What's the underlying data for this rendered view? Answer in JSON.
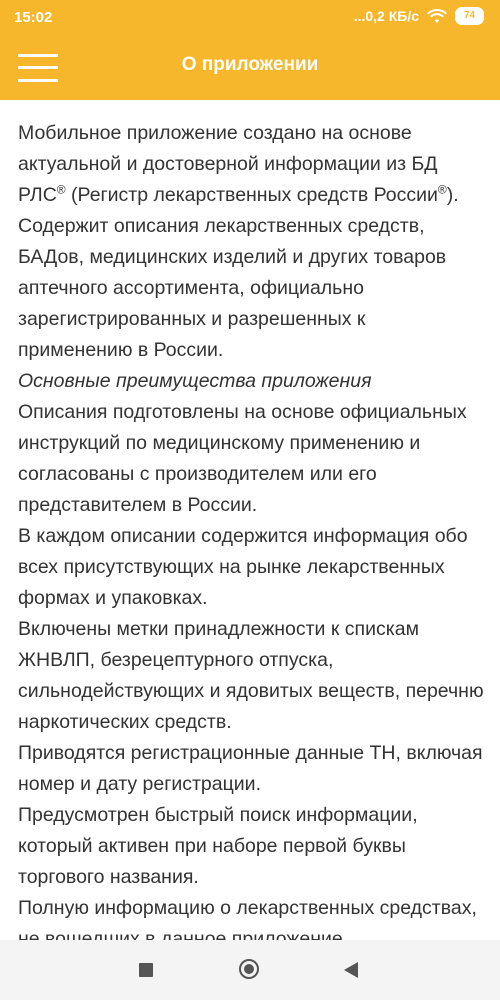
{
  "status_bar": {
    "time": "15:02",
    "network_speed": "...0,2 КБ/с",
    "battery_level": "74",
    "icons": [
      "wifi-icon",
      "battery-icon"
    ]
  },
  "app_bar": {
    "title": "О приложении",
    "menu_icon": "hamburger-menu-icon",
    "background_color": "#f7b72d",
    "text_color": "#ffffff"
  },
  "content": {
    "intro_part1": "Мобильное приложение создано на основе актуальной и достоверной информации из БД РЛС",
    "registered_mark": "®",
    "intro_part2": " (Регистр лекарственных средств России",
    "intro_part3": "). Содержит описания лекарственных средств, БАДов, медицинских изделий и других товаров аптечного ассортимента, официально зарегистрированных и разрешенных к применению в России.",
    "advantages_heading": "Основные преимущества приложения",
    "paragraphs": [
      "Описания подготовлены на основе официальных инструкций по медицинскому применению и согласованы с производителем или его представителем в России.",
      "В каждом описании содержится информация обо всех присутствующих на рынке лекарственных формах и упаковках.",
      "Включены метки принадлежности к спискам ЖНВЛП, безрецептурного отпуска, сильнодействующих и ядовитых веществ, перечню наркотических средств.",
      "Приводятся регистрационные данные ТН, включая номер и дату регистрации.",
      "Предусмотрен быстрый поиск информации, который активен при наборе первой буквы торгового названия.",
      "Полную информацию о лекарственных средствах, не вошедших в данное приложение,"
    ]
  },
  "nav_bar": {
    "icons": [
      "recent-apps-icon",
      "home-icon",
      "back-icon"
    ]
  }
}
